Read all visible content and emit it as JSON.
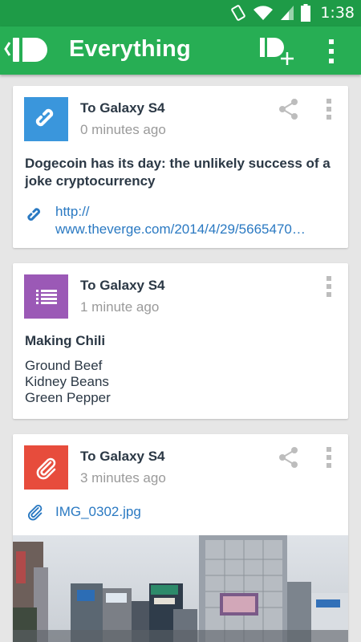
{
  "status_bar": {
    "time": "1:38"
  },
  "app_bar": {
    "title": "Everything",
    "icons": {
      "back": "back-chevron-icon",
      "logo": "pushbullet-logo-icon",
      "push": "new-push-icon",
      "overflow": "overflow-menu-icon"
    },
    "colors": {
      "primary": "#27ae54",
      "status": "#1e9b47"
    }
  },
  "pushes": [
    {
      "target": "To Galaxy S4",
      "time_ago": "0 minutes ago",
      "type": "link",
      "icon": "link-icon",
      "icon_color": "#3a96dc",
      "title": "Dogecoin has its day: the unlikely success of a joke cryptocurrency",
      "url_line1": "http://",
      "url_line2": "www.theverge.com/2014/4/29/5665470…"
    },
    {
      "target": "To Galaxy S4",
      "time_ago": "1 minute ago",
      "type": "list",
      "icon": "list-icon",
      "icon_color": "#9b59b6",
      "title": "Making Chili",
      "items": [
        "Ground Beef",
        "Kidney Beans",
        "Green Pepper"
      ]
    },
    {
      "target": "To Galaxy S4",
      "time_ago": "3 minutes ago",
      "type": "file",
      "icon": "paperclip-icon",
      "icon_color": "#e74c3c",
      "file_name": "IMG_0302.jpg"
    }
  ]
}
